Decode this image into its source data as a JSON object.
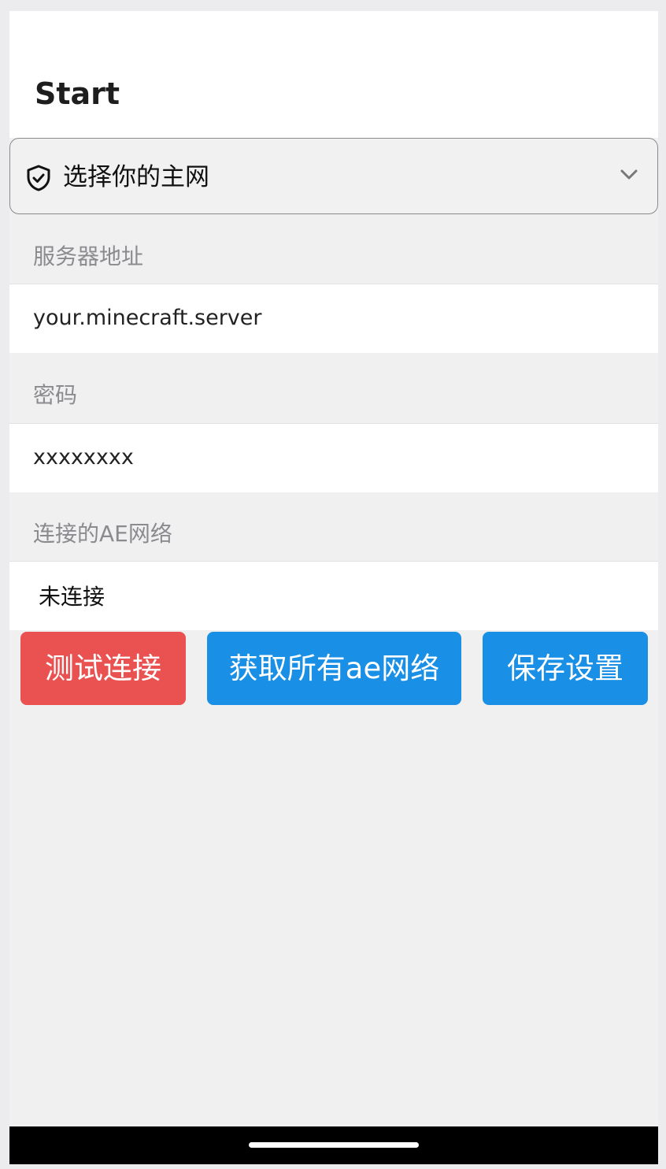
{
  "header": {
    "title": "Start"
  },
  "network_selector": {
    "label": "选择你的主网",
    "icon": "shield-check-icon",
    "chevron": "chevron-down-icon"
  },
  "server": {
    "section_label": "服务器地址",
    "value": "your.minecraft.server"
  },
  "password": {
    "section_label": "密码",
    "value": "xxxxxxxx"
  },
  "ae_network": {
    "section_label": "连接的AE网络",
    "status": "未连接"
  },
  "buttons": {
    "test_connection": "测试连接",
    "get_all_networks": "获取所有ae网络",
    "save_settings": "保存设置"
  },
  "colors": {
    "danger": "#ea5151",
    "primary": "#1a8fe6"
  }
}
